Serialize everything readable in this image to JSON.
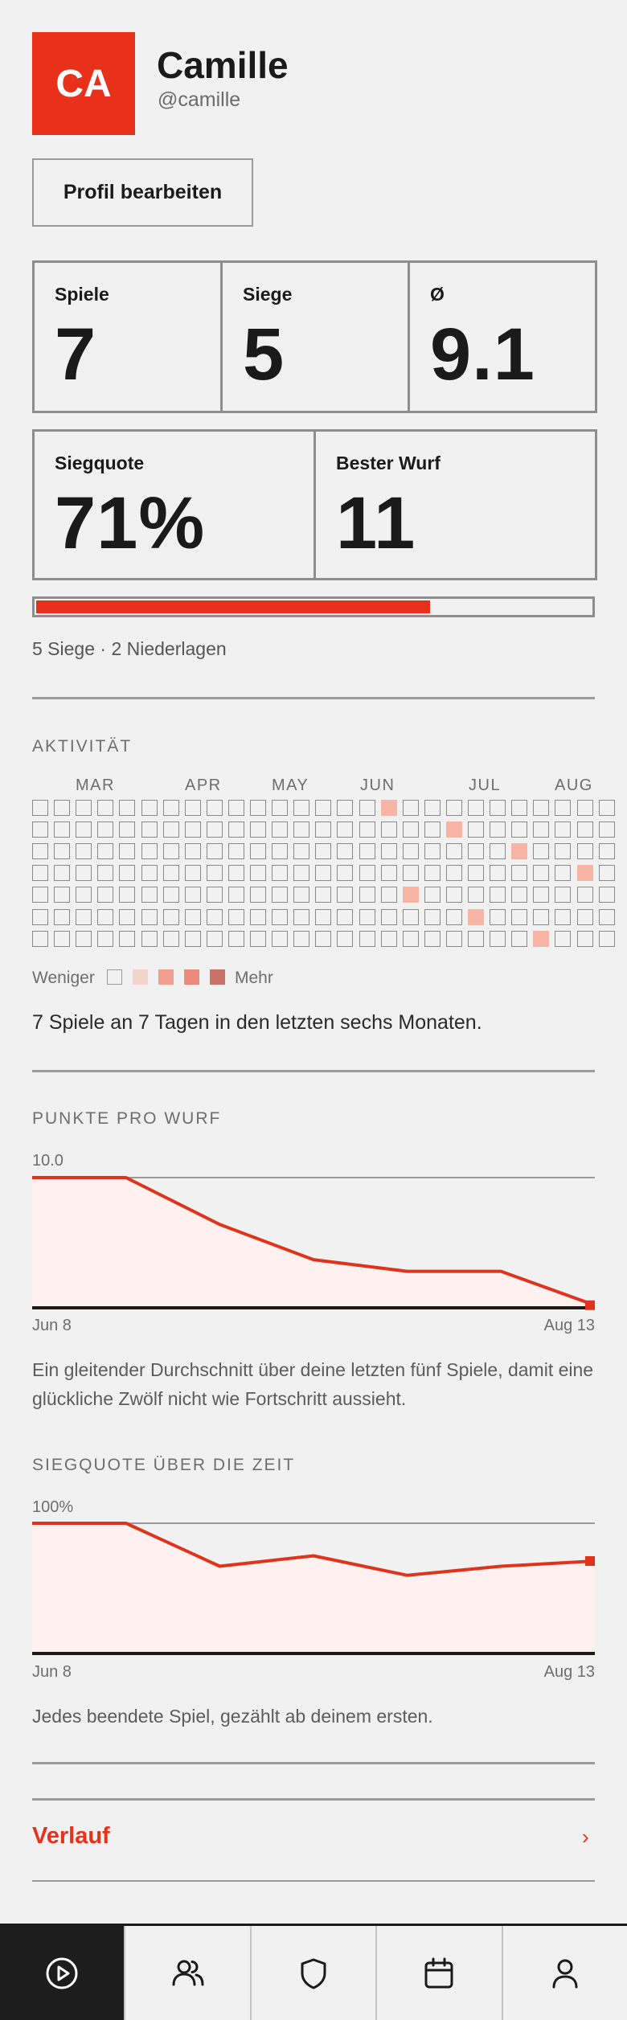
{
  "profile": {
    "initials": "CA",
    "name": "Camille",
    "handle": "@camille",
    "edit_label": "Profil bearbeiten"
  },
  "stats": [
    {
      "label": "Spiele",
      "value": "7"
    },
    {
      "label": "Siege",
      "value": "5"
    },
    {
      "label": "Ø",
      "value": "9.1"
    },
    {
      "label": "Siegquote",
      "value": "71%"
    },
    {
      "label": "Bester Wurf",
      "value": "11"
    }
  ],
  "record": {
    "win_fraction": 0.71,
    "text": "5 Siege · 2 Niederlagen"
  },
  "activity": {
    "title": "AKTIVITÄT",
    "months": [
      "MAR",
      "APR",
      "MAY",
      "JUN",
      "JUL",
      "AUG"
    ],
    "weeks": 27,
    "days_in_last_week": 7,
    "active_cells": [
      [
        16,
        0
      ],
      [
        19,
        1
      ],
      [
        22,
        2
      ],
      [
        25,
        3
      ],
      [
        17,
        4
      ],
      [
        20,
        5
      ],
      [
        23,
        6
      ]
    ],
    "legend_less": "Weniger",
    "legend_more": "Mehr",
    "legend_colors": [
      "#f1f1f1",
      "#f6d3ca",
      "#f29f90",
      "#ee8a7c",
      "#c97268"
    ],
    "summary": "7 Spiele an 7 Tagen in den letzten sechs Monaten."
  },
  "points_chart": {
    "title": "PUNKTE PRO WURF",
    "max_label": "10.0",
    "x_start": "Jun 8",
    "x_end": "Aug 13",
    "caption": "Ein gleitender Durchschnitt über deine letzten fünf Spiele, damit eine glückliche Zwölf nicht wie Fortschritt aussieht."
  },
  "winrate_chart": {
    "title": "SIEGQUOTE ÜBER DIE ZEIT",
    "max_label": "100%",
    "x_start": "Jun 8",
    "x_end": "Aug 13",
    "caption": "Jedes beendete Spiel, gezählt ab deinem ersten."
  },
  "chart_data": [
    {
      "type": "area",
      "title": "PUNKTE PRO WURF",
      "x": [
        "Jun 8",
        "",
        "",
        "",
        "",
        "",
        "Aug 13"
      ],
      "values": [
        10.0,
        10.0,
        6.4,
        3.7,
        2.8,
        2.8,
        0.2
      ],
      "ylim": [
        0,
        10
      ],
      "y_max_label": "10.0",
      "color": "#e0331c"
    },
    {
      "type": "area",
      "title": "SIEGQUOTE ÜBER DIE ZEIT",
      "x": [
        "Jun 8",
        "",
        "",
        "",
        "",
        "",
        "Aug 13"
      ],
      "values": [
        100,
        100,
        67,
        75,
        60,
        67,
        71
      ],
      "ylim": [
        0,
        100
      ],
      "y_max_label": "100%",
      "color": "#e0331c"
    }
  ],
  "history": {
    "label": "Verlauf",
    "chevron": "›"
  },
  "tabbar": [
    {
      "name": "play-icon",
      "active": true
    },
    {
      "name": "friends-icon",
      "active": false
    },
    {
      "name": "shield-icon",
      "active": false
    },
    {
      "name": "calendar-icon",
      "active": false
    },
    {
      "name": "profile-icon",
      "active": false
    }
  ],
  "colors": {
    "accent": "#e8301a",
    "background": "#f1f1f1",
    "area_fill": "#fff1ef"
  }
}
